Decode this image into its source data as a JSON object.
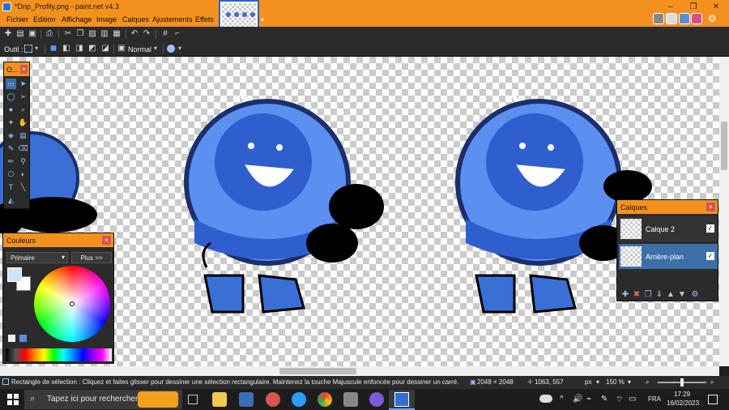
{
  "window": {
    "title": "*Drip_Profily.png - paint.net v4.3",
    "minimize": "–",
    "restore": "❐",
    "close": "✕"
  },
  "menu": {
    "items": [
      "Fichier",
      "Edition",
      "Affichage",
      "Image",
      "Calques",
      "Ajustements",
      "Effets"
    ]
  },
  "toolbar2": {
    "tool_label": "Outil :",
    "blend_mode": "Normal"
  },
  "tools_panel": {
    "title": "O..."
  },
  "colors_panel": {
    "title": "Couleurs",
    "selector_value": "Primaire",
    "more_button": "Plus >>"
  },
  "layers_panel": {
    "title": "Calques",
    "layers": [
      {
        "name": "Calque 2",
        "visible": true,
        "selected": false
      },
      {
        "name": "Arrière-plan",
        "visible": true,
        "selected": true
      }
    ]
  },
  "status": {
    "hint": "Rectangle de sélection : Cliquez et faites glisser pour dessiner une sélection rectangulaire. Maintenez la touche Majuscule enfoncée pour dessiner un carré.",
    "image_size": "2048 × 2048",
    "cursor_pos": "1063, 557",
    "units": "px",
    "zoom": "150 %"
  },
  "taskbar": {
    "search_placeholder": "Tapez ici pour rechercher",
    "language": "FRA",
    "time": "17:29",
    "date": "16/02/2023"
  },
  "colors": {
    "accent": "#f4911e",
    "panel_bg": "#2b2b2b",
    "selected_layer": "#3d6fa8",
    "character_blue": "#3a6fd6"
  }
}
